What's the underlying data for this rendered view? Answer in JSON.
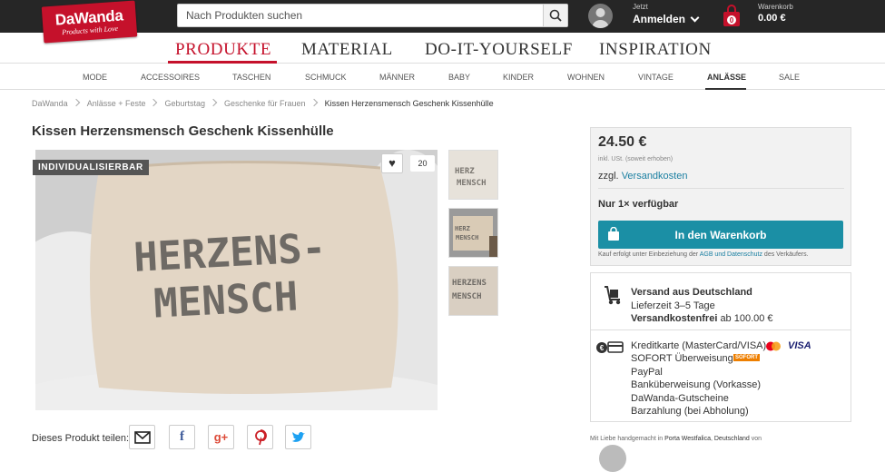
{
  "header": {
    "logo_name": "DaWanda",
    "logo_slogan": "Products with Love",
    "search_placeholder": "Nach Produkten suchen",
    "user_small": "Jetzt",
    "user_big": "Anmelden",
    "cart_small": "Warenkorb",
    "cart_total": "0.00 €",
    "cart_count": "0"
  },
  "main_nav": [
    "PRODUKTE",
    "MATERIAL",
    "DO-IT-YOURSELF",
    "INSPIRATION"
  ],
  "sub_nav": [
    "MODE",
    "ACCESSOIRES",
    "TASCHEN",
    "SCHMUCK",
    "MÄNNER",
    "BABY",
    "KINDER",
    "WOHNEN",
    "VINTAGE",
    "ANLÄSSE",
    "SALE"
  ],
  "breadcrumb": [
    "DaWanda",
    "Anlässe + Feste",
    "Geburtstag",
    "Geschenke für Frauen",
    "Kissen Herzensmensch Geschenk Kissenhülle"
  ],
  "product": {
    "title": "Kissen Herzensmensch Geschenk Kissenhülle",
    "badge": "INDIVIDUALISIERBAR",
    "favorite_count": "20",
    "share_label": "Dieses Produkt teilen:",
    "image_text_line1": "HERZENS-",
    "image_text_line2": "MENSCH"
  },
  "purchase": {
    "price": "24.50 €",
    "tax_note": "inkl. USt. (soweit erhoben)",
    "shipping_prefix": "zzgl.",
    "shipping_link": "Versandkosten",
    "availability": "Nur 1× verfügbar",
    "cta": "In den Warenkorb",
    "legal_pre": "Kauf erfolgt unter Einbeziehung der",
    "legal_link": "AGB und Datenschutz",
    "legal_post": "des Verkäufers."
  },
  "delivery": {
    "title": "Versand aus Deutschland",
    "time": "Lieferzeit 3–5 Tage",
    "free_bold": "Versandkostenfrei",
    "free_rest": "ab 100.00 €"
  },
  "payments": [
    "Kreditkarte (MasterCard/VISA)",
    "SOFORT Überweisung",
    "PayPal",
    "Banküberweisung (Vorkasse)",
    "DaWanda-Gutscheine",
    "Barzahlung (bei Abholung)"
  ],
  "payment_brands": {
    "visa": "VISA",
    "sofort": "SOFORT"
  },
  "footer_note": {
    "pre": "Mit Liebe handgemacht in",
    "place": "Porta Westfalica",
    "mid": ",",
    "country": "Deutschland",
    "post": "von"
  },
  "colors": {
    "brand": "#c5112b",
    "topbar": "#262626",
    "cta": "#1b8fa5",
    "link": "#1a7fa1"
  }
}
